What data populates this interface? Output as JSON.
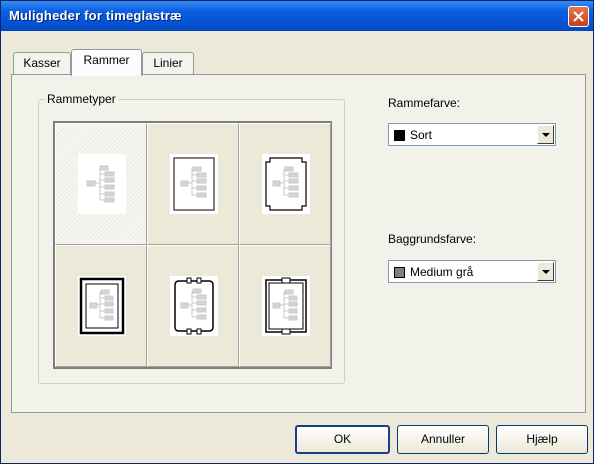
{
  "window": {
    "title": "Muligheder for timeglastræ"
  },
  "tabs": [
    {
      "label": "Kasser",
      "active": false
    },
    {
      "label": "Rammer",
      "active": true
    },
    {
      "label": "Linier",
      "active": false
    }
  ],
  "frame_types": {
    "label": "Rammetyper",
    "options": [
      {
        "icon": "frame-none-icon",
        "selected": true
      },
      {
        "icon": "frame-single-line-icon",
        "selected": false
      },
      {
        "icon": "frame-notched-corners-icon",
        "selected": false
      },
      {
        "icon": "frame-thick-double-icon",
        "selected": false
      },
      {
        "icon": "frame-ornate-icon",
        "selected": false
      },
      {
        "icon": "frame-double-ornate-icon",
        "selected": false
      }
    ]
  },
  "frame_color": {
    "label": "Rammefarve:",
    "value": "Sort",
    "swatch": "#000000"
  },
  "background_color": {
    "label": "Baggrundsfarve:",
    "value": "Medium grå",
    "swatch": "#808080"
  },
  "buttons": {
    "ok": "OK",
    "cancel": "Annuller",
    "help": "Hjælp"
  },
  "colors": {
    "titlebar": "#0554d8",
    "close": "#d9522c",
    "dialog": "#ece9d8"
  }
}
